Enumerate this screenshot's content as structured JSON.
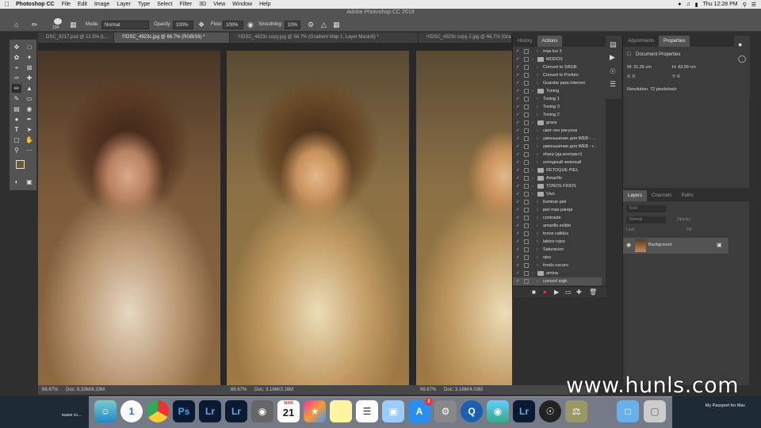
{
  "menubar": {
    "app": "Photoshop CC",
    "items": [
      "File",
      "Edit",
      "Image",
      "Layer",
      "Type",
      "Select",
      "Filter",
      "3D",
      "View",
      "Window",
      "Help"
    ],
    "clock": "Thu 12:28 PM"
  },
  "window_title": "Adobe Photoshop CC 2019",
  "options": {
    "brush_size": "134",
    "mode_label": "Mode:",
    "mode_value": "Normal",
    "opacity_label": "Opacity:",
    "opacity_value": "100%",
    "flow_label": "Flow:",
    "flow_value": "100%",
    "smoothing_label": "Smoothing:",
    "smoothing_value": "10%"
  },
  "tabs": [
    {
      "label": "DSC_9217.psd @ 12.5% (L..."
    },
    {
      "label": "!!!DSC_4923c.jpg @ 66.7% (RGB/16) *"
    },
    {
      "label": "!!!DSC_4923c copy.jpg @ 66.7% (Gradient Map 1, Layer Mask/8) *"
    },
    {
      "label": "!!!DSC_4923c copy 2.jpg @ 66.7% (Gra..."
    }
  ],
  "status": [
    {
      "zoom": "66.67%",
      "doc": "Doc: 8.33M/8.33M"
    },
    {
      "zoom": "66.67%",
      "doc": "Doc: 3.16M/3.16M"
    },
    {
      "zoom": "66.67%",
      "doc": "Doc: 3.16M/4.03M"
    }
  ],
  "history_panel": {
    "tabs": [
      "History",
      "Actions"
    ],
    "rows": [
      {
        "label": "mas luz 3",
        "level": 2,
        "kind": "action"
      },
      {
        "label": "MODOS",
        "level": 1,
        "kind": "set"
      },
      {
        "label": "Convert to SRGB",
        "level": 2,
        "kind": "action"
      },
      {
        "label": "Convert to Prefoto",
        "level": 2,
        "kind": "action"
      },
      {
        "label": "Guardar para Internet",
        "level": 2,
        "kind": "action"
      },
      {
        "label": "Toning",
        "level": 1,
        "kind": "set"
      },
      {
        "label": "Toning 1",
        "level": 2,
        "kind": "action"
      },
      {
        "label": "Toning 3",
        "level": 2,
        "kind": "action"
      },
      {
        "label": "Toning 2",
        "level": 2,
        "kind": "action"
      },
      {
        "label": "grass",
        "level": 1,
        "kind": "set"
      },
      {
        "label": "свет-тен рисунок",
        "level": 2,
        "kind": "action"
      },
      {
        "label": "уменьшение для WEB - ...",
        "level": 2,
        "kind": "action"
      },
      {
        "label": "уменьшение для WEB - г...",
        "level": 2,
        "kind": "action"
      },
      {
        "label": "sharp (да.контраст)",
        "level": 2,
        "kind": "action"
      },
      {
        "label": "холодный зеленый",
        "level": 2,
        "kind": "action"
      },
      {
        "label": "RETOQUE PIEL",
        "level": 1,
        "kind": "set"
      },
      {
        "label": "Amarillo",
        "level": 1,
        "kind": "set"
      },
      {
        "label": "TONOS FRIOS",
        "level": 1,
        "kind": "set"
      },
      {
        "label": "Vivo",
        "level": 1,
        "kind": "set"
      },
      {
        "label": "iluminar piel",
        "level": 2,
        "kind": "action"
      },
      {
        "label": "piel mas pareja",
        "level": 2,
        "kind": "action"
      },
      {
        "label": "contraste",
        "level": 2,
        "kind": "action"
      },
      {
        "label": "amarillo solido",
        "level": 2,
        "kind": "action"
      },
      {
        "label": "tonos calidos",
        "level": 2,
        "kind": "action"
      },
      {
        "label": "labios rojos",
        "level": 2,
        "kind": "action"
      },
      {
        "label": "Saturacion",
        "level": 2,
        "kind": "action"
      },
      {
        "label": "ojos",
        "level": 2,
        "kind": "action"
      },
      {
        "label": "fondo oscuro",
        "level": 2,
        "kind": "action"
      },
      {
        "label": "amina",
        "level": 1,
        "kind": "set"
      },
      {
        "label": "convert srgb",
        "level": 2,
        "kind": "action"
      }
    ]
  },
  "properties_panel": {
    "tabs": [
      "Adjustments",
      "Properties"
    ],
    "section": "Document Properties",
    "w": "W: 31.26 cm",
    "h": "H: 43.09 cm",
    "x": "X: 0",
    "y": "Y: 0",
    "resolution": "Resolution: 72 pixels/inch"
  },
  "layers_panel": {
    "tabs": [
      "Layers",
      "Channels",
      "Paths"
    ],
    "kind_placeholder": "Kind",
    "blend": "Normal",
    "opacity_label": "Opacity:",
    "lock_label": "Lock:",
    "fill_label": "Fill:",
    "layer_name": "Background"
  },
  "dock": {
    "left_text": "suave co...",
    "calendar_month": "MAR",
    "calendar_day": "21",
    "ps": "Ps",
    "lr": "Lr",
    "mail_badge": "2",
    "passport": "My Passport for Mac"
  },
  "watermark": "www.hunls.com"
}
